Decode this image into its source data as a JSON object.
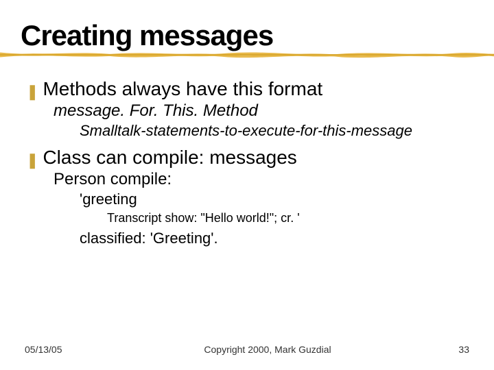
{
  "title": "Creating messages",
  "bullets": {
    "b1": {
      "text": "Methods always have this format",
      "sub1": "message. For. This. Method",
      "sub2": "Smalltalk-statements-to-execute-for-this-message"
    },
    "b2": {
      "text": "Class can compile: messages",
      "sub1": "Person compile:",
      "sub2": "'greeting",
      "sub3": "Transcript show: \"Hello world!\"; cr. '",
      "sub4": "classified: 'Greeting'."
    }
  },
  "footer": {
    "date": "05/13/05",
    "copyright": "Copyright 2000, Mark Guzdial",
    "page": "33"
  }
}
